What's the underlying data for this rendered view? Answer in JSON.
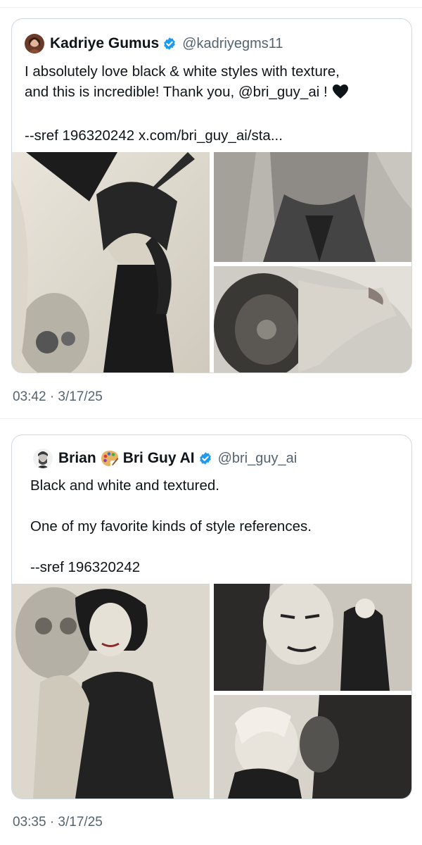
{
  "tweet": {
    "author_name": "Kadriye Gumus",
    "author_handle": "@kadriyegms11",
    "text_line1": "I absolutely love black & white styles with texture,",
    "text_line2": "and this is incredible! Thank you, @bri_guy_ai !",
    "text_line3": "--sref 196320242 x.com/bri_guy_ai/sta...",
    "verified": true,
    "heart_icon": "black-heart-emoji",
    "timestamp": "03:42 · 3/17/25"
  },
  "quoted": {
    "author_name_part1": "Brian",
    "author_name_emoji": "artist-palette-emoji",
    "author_name_part2": "Bri Guy AI",
    "author_handle": "@bri_guy_ai",
    "verified": true,
    "text_line1": "Black and white and textured.",
    "text_line2": "One of my favorite kinds of style references.",
    "text_line3": "--sref 196320242",
    "timestamp": "03:35 · 3/17/25"
  },
  "colors": {
    "text": "#0f1419",
    "secondary": "#536471",
    "border": "#cfd9de",
    "verified_blue": "#1d9bf0"
  }
}
